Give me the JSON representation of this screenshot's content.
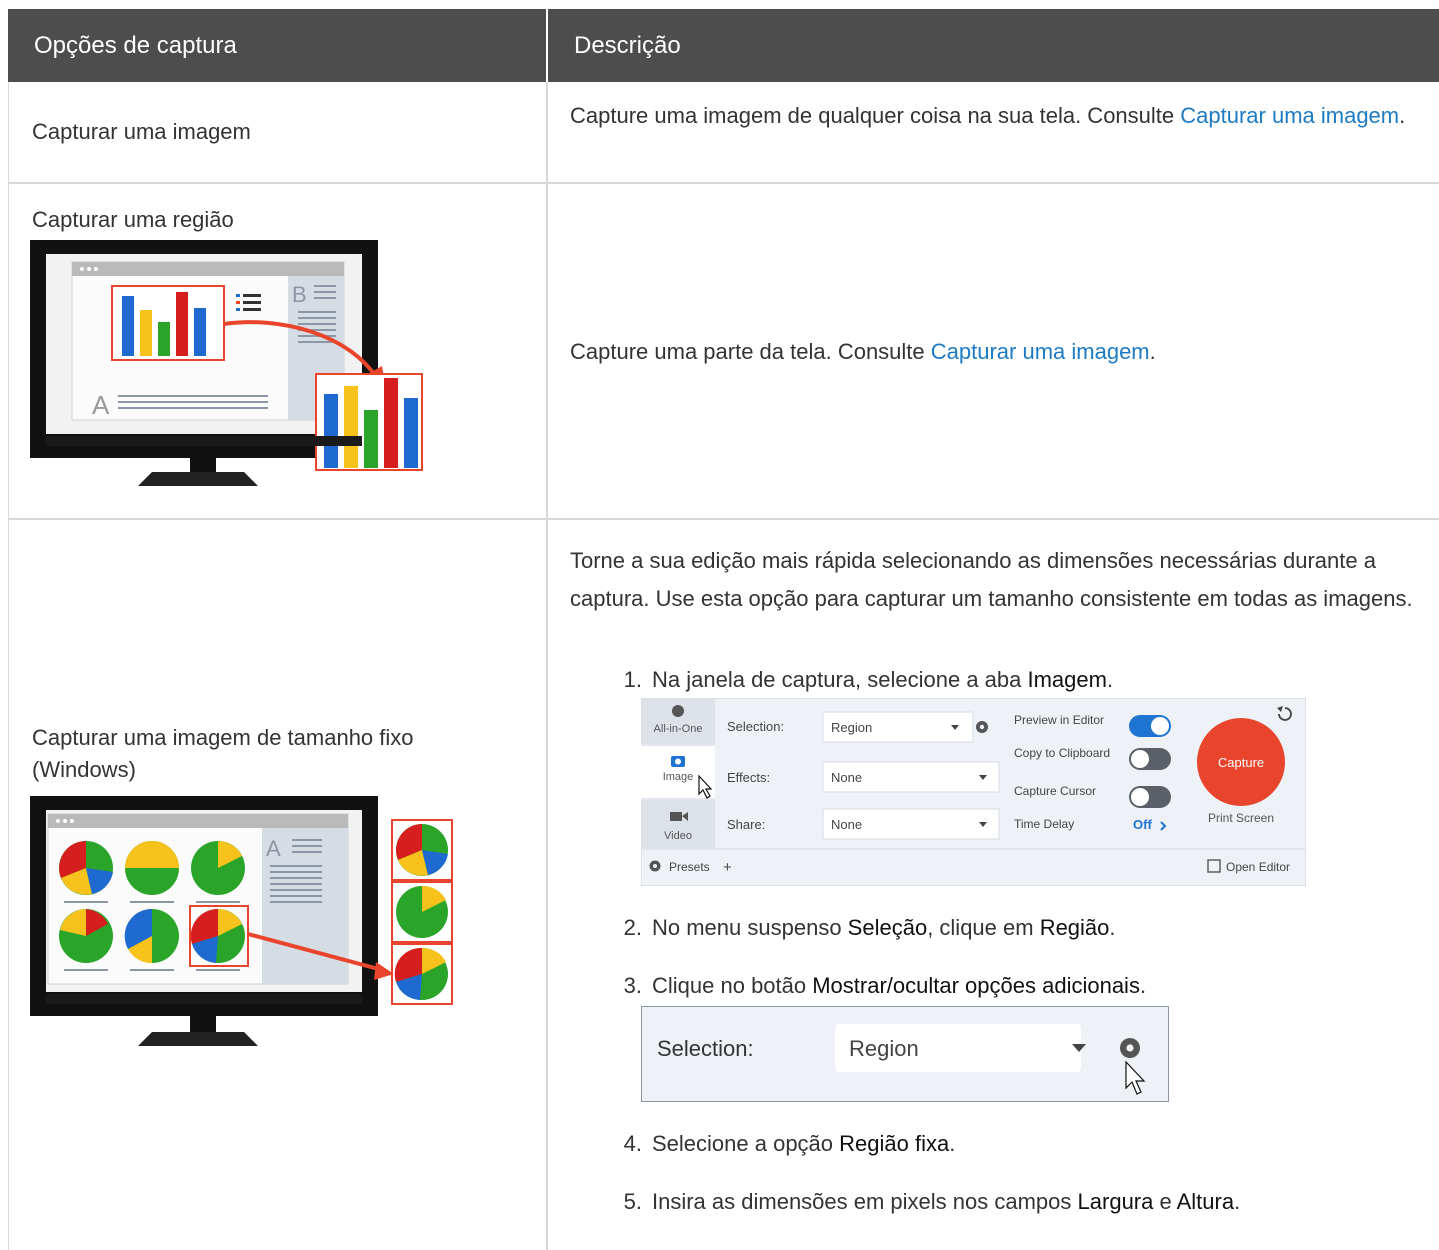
{
  "header": {
    "col1": "Opções de captura",
    "col2": "Descrição"
  },
  "row1": {
    "option": "Capturar uma imagem",
    "desc_before": "Capture uma imagem de qualquer coisa na sua tela. Consulte ",
    "desc_link": "Capturar uma imagem",
    "desc_after": "."
  },
  "row2": {
    "option": "Capturar uma região",
    "desc_before": "Capture uma parte da tela. Consulte ",
    "desc_link": "Capturar uma imagem",
    "desc_after": ".",
    "illustration": {
      "left_letter": "A",
      "right_letter": "B"
    }
  },
  "row3": {
    "option_line1": "Capturar uma imagem de tamanho fixo",
    "option_line2": "(Windows)",
    "intro": "Torne a sua edição mais rápida selecionando as dimensões necessárias durante a captura. Use esta opção para capturar um tamanho consistente em todas as imagens.",
    "illustration": {
      "right_letter": "A"
    },
    "steps": [
      {
        "num": "1.",
        "before": "Na janela de captura, selecione a aba ",
        "b1": "Imagem",
        "mid": "",
        "b2": "",
        "after": "."
      },
      {
        "num": "2.",
        "before": "No menu suspenso ",
        "b1": "Seleção",
        "mid": ", clique em ",
        "b2": "Região",
        "after": "."
      },
      {
        "num": "3.",
        "before": "Clique no botão ",
        "b1": "Mostrar/ocultar opções adicionais",
        "mid": "",
        "b2": "",
        "after": "."
      },
      {
        "num": "4.",
        "before": "Selecione a opção ",
        "b1": "Região fixa",
        "mid": "",
        "b2": "",
        "after": "."
      },
      {
        "num": "5.",
        "before": "Insira as dimensões em pixels nos campos ",
        "b1": "Largura",
        "mid": " e ",
        "b2": "Altura",
        "after": "."
      }
    ]
  },
  "capture_window": {
    "tabs": [
      "All-in-One",
      "Image",
      "Video"
    ],
    "selection_label": "Selection:",
    "selection_value": "Region",
    "effects_label": "Effects:",
    "effects_value": "None",
    "share_label": "Share:",
    "share_value": "None",
    "preview_label": "Preview in Editor",
    "clipboard_label": "Copy to Clipboard",
    "cursor_label": "Capture Cursor",
    "delay_label": "Time Delay",
    "delay_value": "Off",
    "capture_button": "Capture",
    "print_screen": "Print Screen",
    "presets": "Presets",
    "open_editor": "Open Editor",
    "colors": {
      "accent": "#1e74d0",
      "capture": "#e8452c"
    }
  },
  "selection_zoom": {
    "label": "Selection:",
    "value": "Region"
  }
}
